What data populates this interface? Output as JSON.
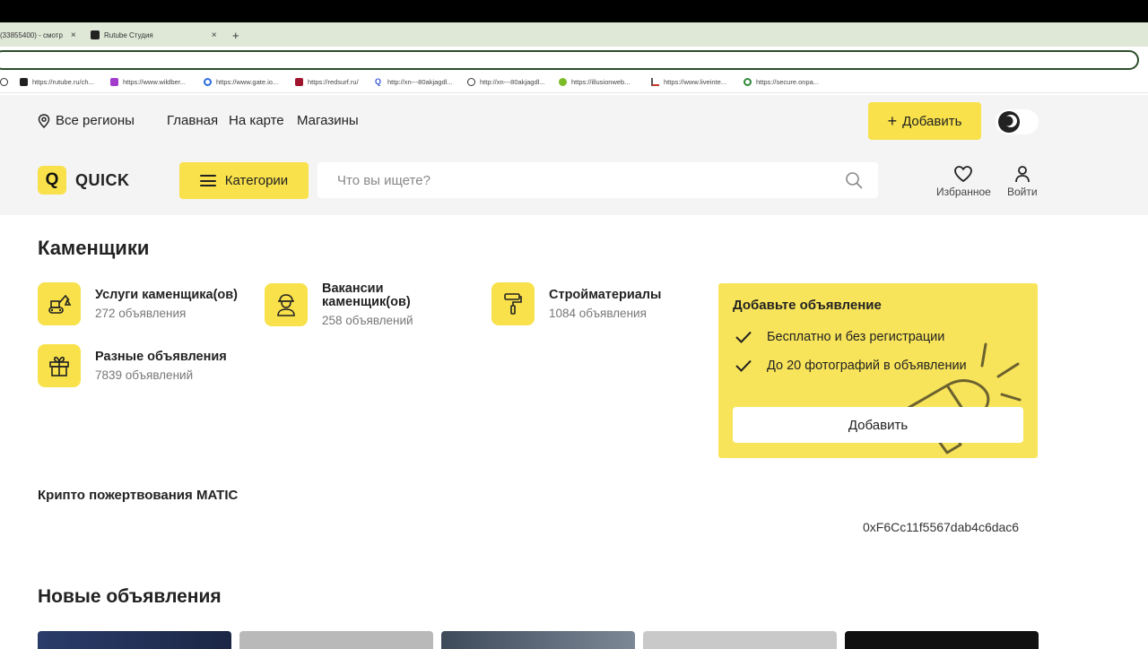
{
  "browser": {
    "tabs": [
      {
        "label": "(33855400) - смотр"
      },
      {
        "label": "Rutube Студия"
      }
    ],
    "new_tab_label": "+",
    "close_glyph": "×",
    "bookmarks": [
      {
        "label": "https://rutube.ru/ch...",
        "icon": "rutube-icon",
        "color": "#222"
      },
      {
        "label": "https://www.wildber...",
        "icon": "wildberries-icon",
        "color": "#a33bcb"
      },
      {
        "label": "https://www.gate.io...",
        "icon": "gate-icon",
        "color": "#2d6bde"
      },
      {
        "label": "https://redsurf.ru/",
        "icon": "redsurf-icon",
        "color": "#a0152e"
      },
      {
        "label": "http://xn---80akjagdl...",
        "icon": "search-q-icon",
        "color": "#3a5bd9"
      },
      {
        "label": "http://xn---80akjagdl...",
        "icon": "globe-icon",
        "color": "#333"
      },
      {
        "label": "https://illusionweb...",
        "icon": "illusion-icon",
        "color": "#7cbc28"
      },
      {
        "label": "https://www.livеinte...",
        "icon": "chart-icon",
        "color": "#c0392b"
      },
      {
        "label": "https://secure.onpa...",
        "icon": "power-icon",
        "color": "#2e8b3a"
      }
    ]
  },
  "header": {
    "region": "Все регионы",
    "nav": [
      "Главная",
      "На карте",
      "Магазины"
    ],
    "add_button": "Добавить",
    "add_plus": "+",
    "logo_letter": "Q",
    "logo_text": "QUICK",
    "categories_button": "Категории",
    "search_placeholder": "Что вы ищете?",
    "favorites": "Избранное",
    "login": "Войти"
  },
  "main": {
    "title": "Каменщики",
    "categories": [
      {
        "title": "Услуги каменщика(ов)",
        "count": "272 объявления",
        "icon": "excavator-icon"
      },
      {
        "title": "Вакансии каменщик(ов)",
        "count": "258 объявлений",
        "icon": "worker-icon"
      },
      {
        "title": "Стройматериалы",
        "count": "1084 объявления",
        "icon": "paint-roller-icon"
      },
      {
        "title": "Разные объявления",
        "count": "7839 объявлений",
        "icon": "gift-icon"
      }
    ],
    "promo": {
      "title": "Добавьте объявление",
      "items": [
        "Бесплатно и без регистрации",
        "До 20 фотографий в объявлении"
      ],
      "button": "Добавить"
    },
    "crypto_title": "Крипто пожертвования MATIC",
    "crypto_address": "0xF6Cc11f5567dab4c6dac6",
    "new_ads_title": "Новые объявления"
  },
  "colors": {
    "accent": "#f8e14a",
    "header_bg": "#f4f4f4"
  }
}
